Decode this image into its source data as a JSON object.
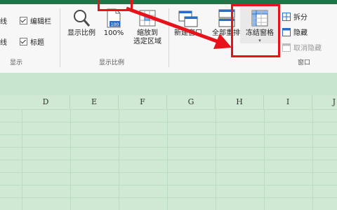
{
  "ribbon": {
    "show_group": {
      "label": "显示",
      "left_fragment": "线",
      "formula_bar": "编辑栏",
      "headings": "标题"
    },
    "zoom_group": {
      "label": "显示比例",
      "zoom": "显示比例",
      "hundred": "100%",
      "hundred_icon_text": "100",
      "zoom_selection": [
        "缩放到",
        "选定区域"
      ]
    },
    "window_group": {
      "label": "窗口",
      "new_window": "新建窗口",
      "arrange_all": "全部重排",
      "freeze_panes": "冻结窗格",
      "split": "拆分",
      "hide": "隐藏",
      "unhide": "取消隐藏"
    }
  },
  "sheet": {
    "columns": [
      "D",
      "E",
      "F",
      "G",
      "H",
      "I",
      "J"
    ]
  },
  "colors": {
    "accent_red": "#e8121b",
    "sheet_green": "#cfe9d5",
    "excel_green": "#217346"
  }
}
